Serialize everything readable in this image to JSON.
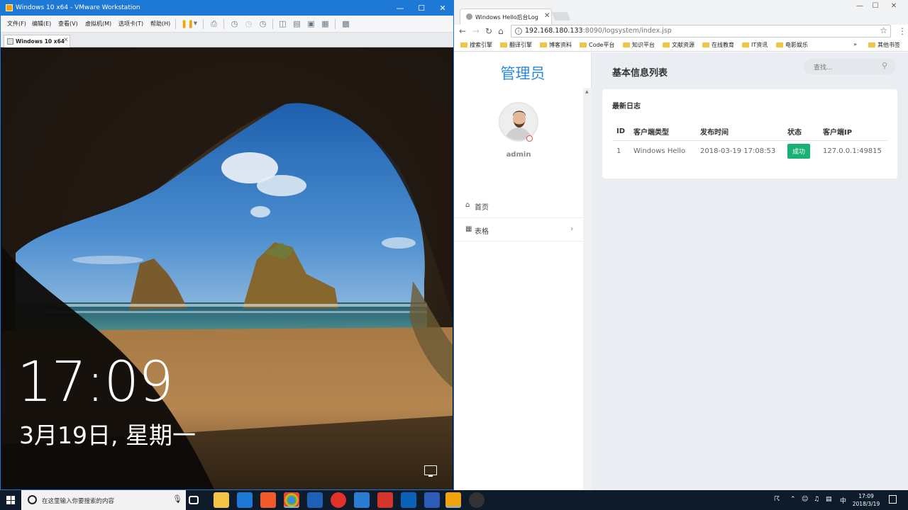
{
  "vmware": {
    "title": "Windows 10 x64 - VMware Workstation",
    "menu": [
      "文件(F)",
      "编辑(E)",
      "查看(V)",
      "虚拟机(M)",
      "选项卡(T)",
      "帮助(H)"
    ],
    "tab_label": "Windows 10 x64",
    "lock_time": "17:09",
    "lock_date": "3月19日, 星期一"
  },
  "browser": {
    "tab_title": "Windows Hello后台Log",
    "url_host": "192.168.180.133",
    "url_path": ":8090/logsystem/index.jsp",
    "bookmarks": [
      "搜索引擎",
      "翻译引擎",
      "博客资料",
      "Code平台",
      "知识平台",
      "文献资源",
      "在线教育",
      "IT资讯",
      "电影娱乐"
    ],
    "bookmarks_more": "»",
    "bookmarks_other": "其他书签"
  },
  "app": {
    "brand": "管理员",
    "username": "admin",
    "nav": [
      {
        "icon": "home-icon",
        "label": "首页"
      },
      {
        "icon": "table-icon",
        "label": "表格"
      }
    ],
    "page_title": "基本信息列表",
    "search_placeholder": "查找...",
    "card_title": "最新日志",
    "table": {
      "columns": [
        "ID",
        "客户端类型",
        "发布时间",
        "状态",
        "客户端IP"
      ],
      "rows": [
        [
          "1",
          "Windows Hello",
          "2018-03-19 17:08:53",
          "成功",
          "127.0.0.1:49815"
        ]
      ]
    },
    "colors": {
      "brand": "#2a8bdc",
      "success": "#1ab174"
    }
  },
  "taskbar": {
    "search_placeholder": "在这里输入你要搜索的内容",
    "ime": "中",
    "time": "17:09",
    "date": "2018/3/19"
  }
}
